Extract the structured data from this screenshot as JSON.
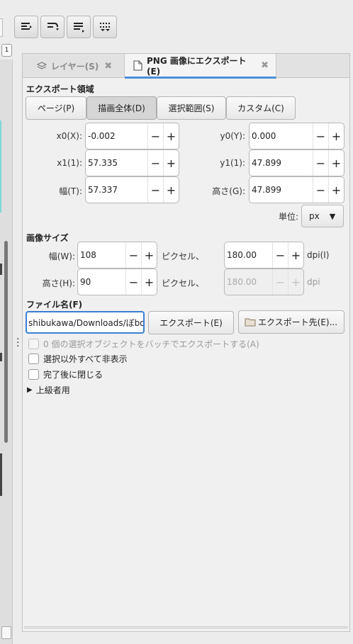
{
  "toolbar": {
    "icons": [
      "align-right-icon",
      "align-curve-icon",
      "align-lines-icon",
      "align-grid-icon"
    ]
  },
  "tabs": [
    {
      "label": "レイヤー(S)",
      "icon": "layers-icon"
    },
    {
      "label": "PNG 画像にエクスポート(E)",
      "icon": "document-icon"
    }
  ],
  "export_area": {
    "title": "エクスポート領域",
    "buttons": [
      "ページ(P)",
      "描画全体(D)",
      "選択範囲(S)",
      "カスタム(C)"
    ],
    "x0_label": "x0(X):",
    "x0": "-0.002",
    "y0_label": "y0(Y):",
    "y0": "0.000",
    "x1_label": "x1(1):",
    "x1": "57.335",
    "y1_label": "y1(1):",
    "y1": "47.899",
    "width_label": "幅(T):",
    "width": "57.337",
    "height_label": "高さ(G):",
    "height": "47.899",
    "unit_label": "単位:",
    "unit": "px"
  },
  "image_size": {
    "title": "画像サイズ",
    "width_label": "幅(W):",
    "width": "108",
    "height_label": "高さ(H):",
    "height": "90",
    "pixels_label": "ピクセル、",
    "dpi_value": "180.00",
    "dpi_label": "dpi(I)",
    "dpi_value2": "180.00",
    "dpi_label2": "dpi"
  },
  "filename": {
    "title": "ファイル名(F)",
    "value": "shibukawa/Downloads/ぼbox",
    "export_button": "エクスポート(E)",
    "export_as_button": "エクスポート先(E)..."
  },
  "options": {
    "batch": "0 個の選択オブジェクトをバッチでエクスポートする(A)",
    "hide_all": "選択以外すべて非表示",
    "close_when_done": "完了後に閉じる",
    "advanced": "上級者用"
  },
  "plus": "+",
  "minus": "−",
  "close_x": "✖",
  "tab_marker": "1",
  "dropdown_arrow": "▼",
  "expander_arrow": "▶"
}
